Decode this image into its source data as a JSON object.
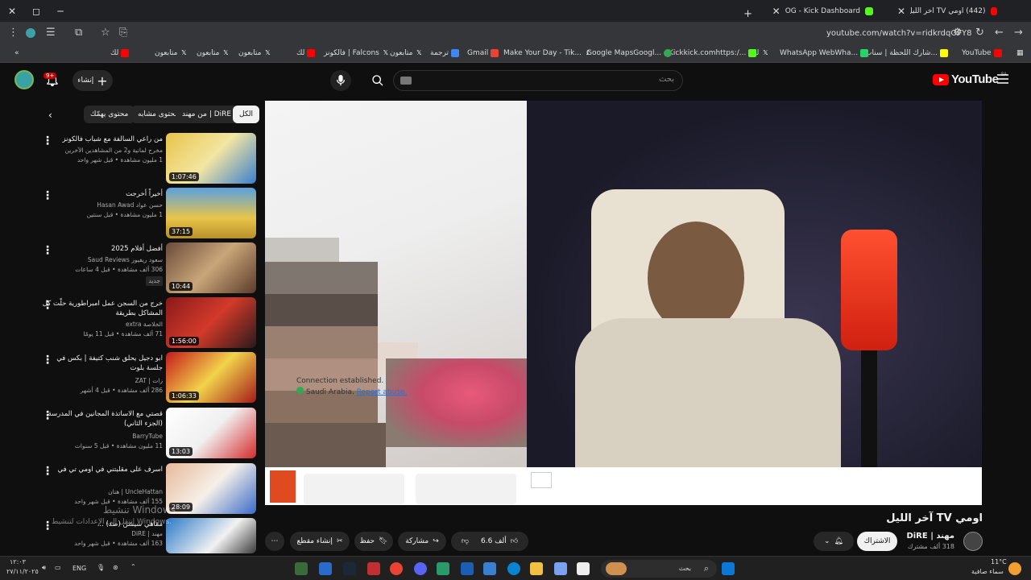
{
  "browser": {
    "tabs": [
      {
        "title": "(442) اومي TV آخر الليل - YouTube",
        "active": true
      },
      {
        "title": "OG - Kick Dashboard",
        "active": false
      }
    ],
    "url": "youtube.com/watch?v=ridkrdqOFY8",
    "bookmarks": [
      "YouTube",
      "شارك اللحظة | سناب...",
      "WhatsApp WebWha...",
      "لك",
      "Kickkick.comhttps:/...",
      "Google MapsGoogl...",
      "Make Your Day - Tik...",
      "Gmail",
      "ترجمة",
      "متابعون",
      "فالكونز | Falcons",
      "لك",
      "متابعون",
      "متابعون",
      "متابعون",
      "لك"
    ]
  },
  "header": {
    "logo_text": "YouTube",
    "logo_region": "SA",
    "search_placeholder": "بحث",
    "create_label": "إنشاء",
    "notification_count": "9+"
  },
  "chips": [
    "الكل",
    "من مهند | DiRE",
    "محتوى مشابه",
    "محتوى يهمّك"
  ],
  "recommendations": [
    {
      "title": "من راعي السالفة مع شباب فالكونز",
      "channel": "مخرج لمانية و2 من المشاهدين الآخرين",
      "meta": "1 مليون مشاهدة • قبل شهر واحد",
      "duration": "1:07:46"
    },
    {
      "title": "أخيراً أخرجت",
      "channel": "حسن عواد Hasan Awad",
      "meta": "1 مليون مشاهدة • قبل سنتين",
      "duration": "37:15"
    },
    {
      "title": "أفضل أفلام 2025",
      "channel": "سعود ريفيوز Saud Reviews",
      "meta": "306 ألف مشاهدة • قبل 4 ساعات",
      "badge": "جديد",
      "duration": "10:44"
    },
    {
      "title": "خرج من السجن عمل امبراطورية حلّت كل المشاكل بطريقة",
      "channel": "الخلاصة extra",
      "meta": "71 ألف مشاهدة • قبل 11 يومًا",
      "duration": "1:56:00"
    },
    {
      "title": "ابو دجيل يحلق شنب كتيفة | بكس في جلسة بلوت",
      "channel": "زات | ZAT",
      "meta": "286 ألف مشاهدة • قبل 4 أشهر",
      "duration": "1:06:33"
    },
    {
      "title": "قصتي مع الاساتذة المجانين في المدرسة (الجزء الثاني)",
      "channel": "BarryTube",
      "meta": "11 مليون مشاهدة • قبل 5 سنوات",
      "duration": "13:03"
    },
    {
      "title": "اسرف على مقلبتني في اومي تي في",
      "channel": "UncleHattan | هتان",
      "meta": "155 ألف مشاهدة • قبل شهر واحد",
      "duration": "28:09"
    },
    {
      "title": "مقاهي سيشن (ضد) ...",
      "channel": "مهند | DiRE",
      "meta": "163 ألف مشاهدة • قبل شهر واحد",
      "duration": ""
    }
  ],
  "player": {
    "connection_status": "Connection established.",
    "location_text": "Saudi Arabia.",
    "report_label": "Report abuse."
  },
  "video": {
    "title": "اومي TV آخر الليل",
    "channel_name": "مهند | DiRE",
    "subscribers": "318 ألف مشترك",
    "subscribe_label": "الاشتراك",
    "likes": "6.6 ألف",
    "share_label": "مشاركة",
    "save_label": "حفظ",
    "clip_label": "إنشاء مقطع"
  },
  "os": {
    "watermark_line1": "تنشيط Windows",
    "watermark_line2": "انتقل إلى الإعدادات لتنشيط Windows.",
    "search_text": "بحث",
    "lang": "ENG",
    "time": "١٢:٠٣",
    "date": "٢٧/١١/٢٠٢٥",
    "weather_temp": "11°C",
    "weather_desc": "سماء صافية"
  },
  "colors": {
    "accent_red": "#ff0000",
    "bg": "#0f0f0f",
    "chip_bg": "#272727"
  }
}
